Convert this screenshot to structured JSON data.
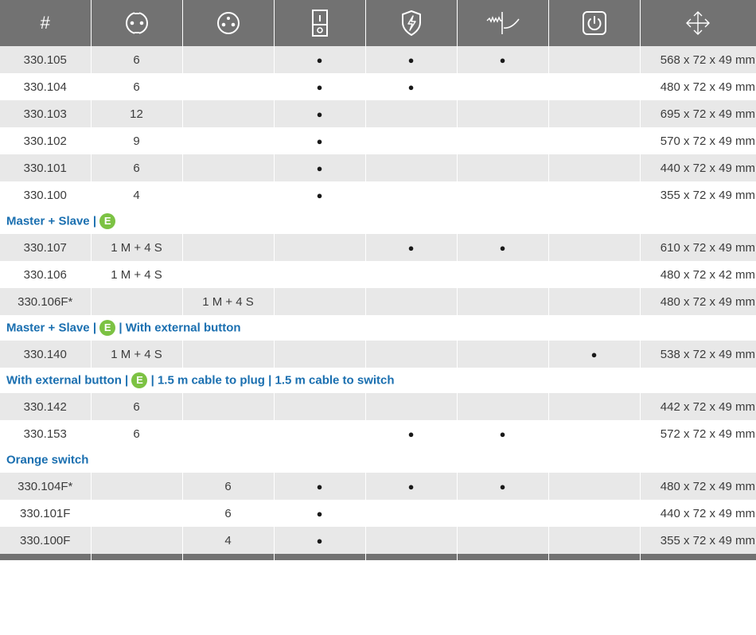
{
  "colors": {
    "header_bg": "#727272",
    "row_shade": "#e8e8e8",
    "section_blue": "#1a6fb0",
    "badge_green": "#7cc243"
  },
  "header": {
    "hash": "#",
    "icons": [
      "schuko-socket-icon",
      "french-socket-icon",
      "rocker-switch-icon",
      "surge-protection-shield-icon",
      "noise-filter-icon",
      "power-button-icon",
      "dimensions-arrows-icon"
    ]
  },
  "groups": [
    {
      "title": null,
      "rows": [
        {
          "c": [
            "330.105",
            "6",
            "",
            "●",
            "●",
            "●",
            "",
            "568 x 72 x 49 mm"
          ]
        },
        {
          "c": [
            "330.104",
            "6",
            "",
            "●",
            "●",
            "",
            "",
            "480 x 72 x 49 mm"
          ]
        },
        {
          "c": [
            "330.103",
            "12",
            "",
            "●",
            "",
            "",
            "",
            "695 x 72 x 49 mm"
          ]
        },
        {
          "c": [
            "330.102",
            "9",
            "",
            "●",
            "",
            "",
            "",
            "570 x 72 x 49 mm"
          ]
        },
        {
          "c": [
            "330.101",
            "6",
            "",
            "●",
            "",
            "",
            "",
            "440 x 72 x 49 mm"
          ]
        },
        {
          "c": [
            "330.100",
            "4",
            "",
            "●",
            "",
            "",
            "",
            "355 x 72 x 49 mm"
          ]
        }
      ]
    },
    {
      "title": {
        "before": "Master + Slave |",
        "badge": "E",
        "after": ""
      },
      "rows": [
        {
          "c": [
            "330.107",
            "1 M + 4 S",
            "",
            "",
            "●",
            "●",
            "",
            "610 x 72 x 49 mm"
          ]
        },
        {
          "c": [
            "330.106",
            "1 M + 4 S",
            "",
            "",
            "",
            "",
            "",
            "480 x 72 x 42 mm"
          ]
        },
        {
          "c": [
            "330.106F*",
            "",
            "1 M + 4 S",
            "",
            "",
            "",
            "",
            "480 x 72 x 49 mm"
          ]
        }
      ]
    },
    {
      "title": {
        "before": "Master + Slave |",
        "badge": "E",
        "after": "| With external button"
      },
      "rows": [
        {
          "c": [
            "330.140",
            "1 M + 4 S",
            "",
            "",
            "",
            "",
            "●",
            "538 x 72 x 49 mm"
          ]
        }
      ]
    },
    {
      "title": {
        "before": "With external button |",
        "badge": "E",
        "after": "| 1.5 m cable to plug | 1.5 m cable to switch"
      },
      "rows": [
        {
          "c": [
            "330.142",
            "6",
            "",
            "",
            "",
            "",
            "",
            "442 x 72 x 49 mm"
          ]
        },
        {
          "c": [
            "330.153",
            "6",
            "",
            "",
            "●",
            "●",
            "",
            "572 x 72 x 49 mm"
          ]
        }
      ]
    },
    {
      "title": {
        "before": "Orange switch",
        "badge": "",
        "after": ""
      },
      "rows": [
        {
          "c": [
            "330.104F*",
            "",
            "6",
            "●",
            "●",
            "●",
            "",
            "480 x 72 x 49 mm"
          ]
        },
        {
          "c": [
            "330.101F",
            "",
            "6",
            "●",
            "",
            "",
            "",
            "440 x 72 x 49 mm"
          ]
        },
        {
          "c": [
            "330.100F",
            "",
            "4",
            "●",
            "",
            "",
            "",
            "355 x 72 x 49 mm"
          ]
        }
      ]
    }
  ]
}
